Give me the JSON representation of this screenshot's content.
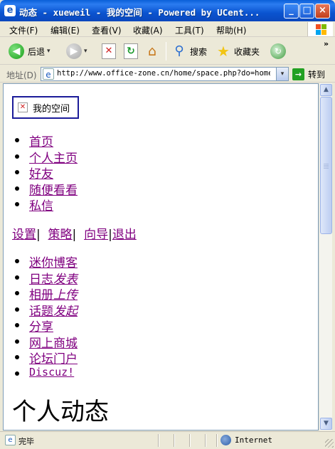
{
  "window": {
    "title": "动态 - xueweil - 我的空间 - Powered by UCent...",
    "icon": "e",
    "min": "_",
    "max": "□",
    "close": "×"
  },
  "menu": [
    "文件(F)",
    "编辑(E)",
    "查看(V)",
    "收藏(A)",
    "工具(T)",
    "帮助(H)"
  ],
  "toolbar": {
    "back_label": "后退",
    "back_glyph": "◀",
    "forward_glyph": "▶",
    "drop_glyph": "▾",
    "stop_glyph": "✕",
    "refresh_glyph": "↻",
    "home_glyph": "⌂",
    "search_label": "搜索",
    "search_glyph": "⚲",
    "favorites_label": "收藏夹",
    "favorites_glyph": "★",
    "media_glyph": "↻",
    "more_glyph": "»"
  },
  "address": {
    "label": "地址(D)",
    "url": "http://www.office-zone.cn/home/space.php?do=home",
    "page_glyph": "e",
    "drop_glyph": "▾",
    "go_label": "转到",
    "go_glyph": "→"
  },
  "page": {
    "logo_alt": "我的空间",
    "logo_broken_glyph": "✕",
    "nav": [
      "首页",
      "个人主页",
      "好友",
      "随便看看",
      "私信"
    ],
    "actions": [
      "设置",
      "策略",
      "向导",
      "退出"
    ],
    "apps": [
      {
        "name": "迷你博客",
        "extra": ""
      },
      {
        "name": "日志",
        "extra": "发表"
      },
      {
        "name": "相册",
        "extra": "上传"
      },
      {
        "name": "话题",
        "extra": "发起"
      },
      {
        "name": "分享",
        "extra": ""
      },
      {
        "name": "网上商城",
        "extra": ""
      },
      {
        "name": "论坛门户",
        "extra": ""
      },
      {
        "name": "Discuz!",
        "extra": ""
      }
    ],
    "feed_title": "个人动态"
  },
  "scrollbar": {
    "up": "▲",
    "down": "▼"
  },
  "status": {
    "text": "完毕",
    "zone": "Internet",
    "page_glyph": "e"
  },
  "colors": {
    "visited_link": "#800080",
    "titlebar": "#0a54d0",
    "logo_border": "#1b1b99"
  }
}
